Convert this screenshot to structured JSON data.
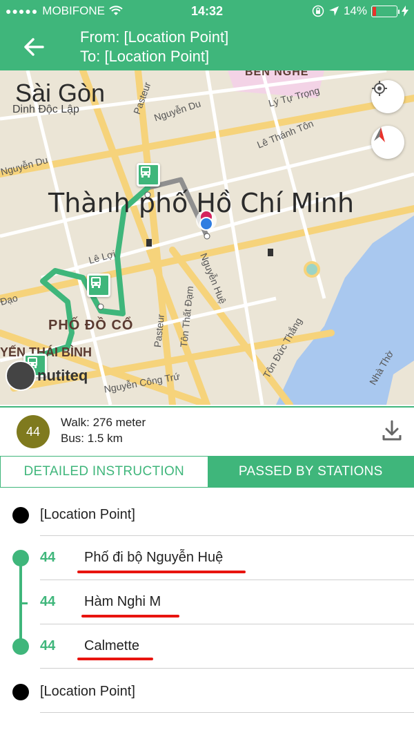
{
  "status_bar": {
    "carrier": "MOBIFONE",
    "time": "14:32",
    "battery": "14%",
    "battery_level": 0.14
  },
  "header": {
    "from": "From: [Location Point]",
    "to": "To: [Location Point]",
    "back_icon": "arrow-left-icon"
  },
  "map": {
    "city": "Thành phố Hồ Chí Minh",
    "district": "Sài Gòn",
    "landmark": "Dinh Độc Lập",
    "quarter": "PHỐ ĐỒ CỔ",
    "ward_left": "YẾN THÁI BÌNH",
    "ward_top": "BẾN NGHÉ",
    "streets": [
      "Nguyễn Du",
      "Pasteur",
      "Lý Tự Trọng",
      "Lê Thánh Tôn",
      "Lê Lợi",
      "Nguyễn Huệ",
      "Tôn Thất Đạm",
      "Pasteur",
      "Tôn Đức Thắng",
      "Nguyễn Công Trứ",
      "Nhà Thờ",
      "Nguyễn Du",
      "Đạo"
    ],
    "attribution": "nutiteq",
    "buttons": [
      "locate-icon",
      "compass-icon"
    ]
  },
  "summary": {
    "route_number": "44",
    "walk": "Walk: 276 meter",
    "bus": "Bus: 1.5 km",
    "download_icon": "download-icon"
  },
  "tabs": {
    "detailed": "DETAILED INSTRUCTION",
    "passed": "PASSED BY STATIONS"
  },
  "list": {
    "start": "[Location Point]",
    "stations": [
      {
        "route": "44",
        "name": "Phố đi bộ Nguyễn Huệ"
      },
      {
        "route": "44",
        "name": "Hàm Nghi M"
      },
      {
        "route": "44",
        "name": "Calmette"
      }
    ],
    "end": "[Location Point]"
  },
  "colors": {
    "brand": "#3fb67b",
    "route_badge": "#7f7a1e",
    "annotation": "#e8140f",
    "battery": "#e8322b"
  }
}
